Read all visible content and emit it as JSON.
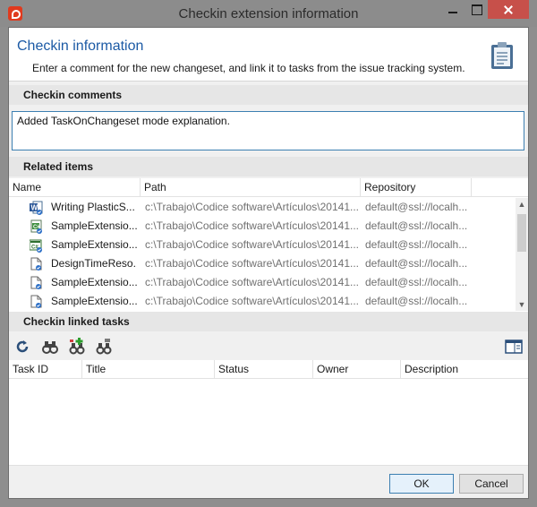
{
  "window": {
    "title": "Checkin extension information"
  },
  "header": {
    "title": "Checkin information",
    "subtitle": "Enter a comment for the new changeset, and link it to tasks from the issue tracking system.",
    "icon": "clipboard-icon"
  },
  "comments": {
    "label": "Checkin comments",
    "value": "Added TaskOnChangeset mode explanation."
  },
  "related": {
    "label": "Related items",
    "columns": [
      "Name",
      "Path",
      "Repository"
    ],
    "rows": [
      {
        "icon": "word-document-icon",
        "name": "Writing PlasticS...",
        "path": "c:\\Trabajo\\Codice software\\Artículos\\20141...",
        "repo": "default@ssl://localh..."
      },
      {
        "icon": "csharp-file-icon",
        "name": "SampleExtensio...",
        "path": "c:\\Trabajo\\Codice software\\Artículos\\20141...",
        "repo": "default@ssl://localh..."
      },
      {
        "icon": "csharp-project-icon",
        "name": "SampleExtensio...",
        "path": "c:\\Trabajo\\Codice software\\Artículos\\20141...",
        "repo": "default@ssl://localh..."
      },
      {
        "icon": "file-icon",
        "name": "DesignTimeReso...",
        "path": "c:\\Trabajo\\Codice software\\Artículos\\20141...",
        "repo": "default@ssl://localh..."
      },
      {
        "icon": "file-icon",
        "name": "SampleExtensio...",
        "path": "c:\\Trabajo\\Codice software\\Artículos\\20141...",
        "repo": "default@ssl://localh..."
      },
      {
        "icon": "file-icon",
        "name": "SampleExtensio...",
        "path": "c:\\Trabajo\\Codice software\\Artículos\\20141...",
        "repo": "default@ssl://localh..."
      }
    ]
  },
  "linked": {
    "label": "Checkin linked tasks",
    "toolbar": [
      "refresh-icon",
      "binoculars-icon",
      "add-task-icon",
      "remove-task-icon",
      "details-panel-icon"
    ],
    "columns": [
      "Task ID",
      "Title",
      "Status",
      "Owner",
      "Description"
    ]
  },
  "footer": {
    "ok_label": "OK",
    "cancel_label": "Cancel"
  },
  "colors": {
    "accent": "#1c5aa5",
    "close_button": "#c7504a",
    "titlebar": "#8c8c8c",
    "focus_border": "#3c7fb1"
  }
}
